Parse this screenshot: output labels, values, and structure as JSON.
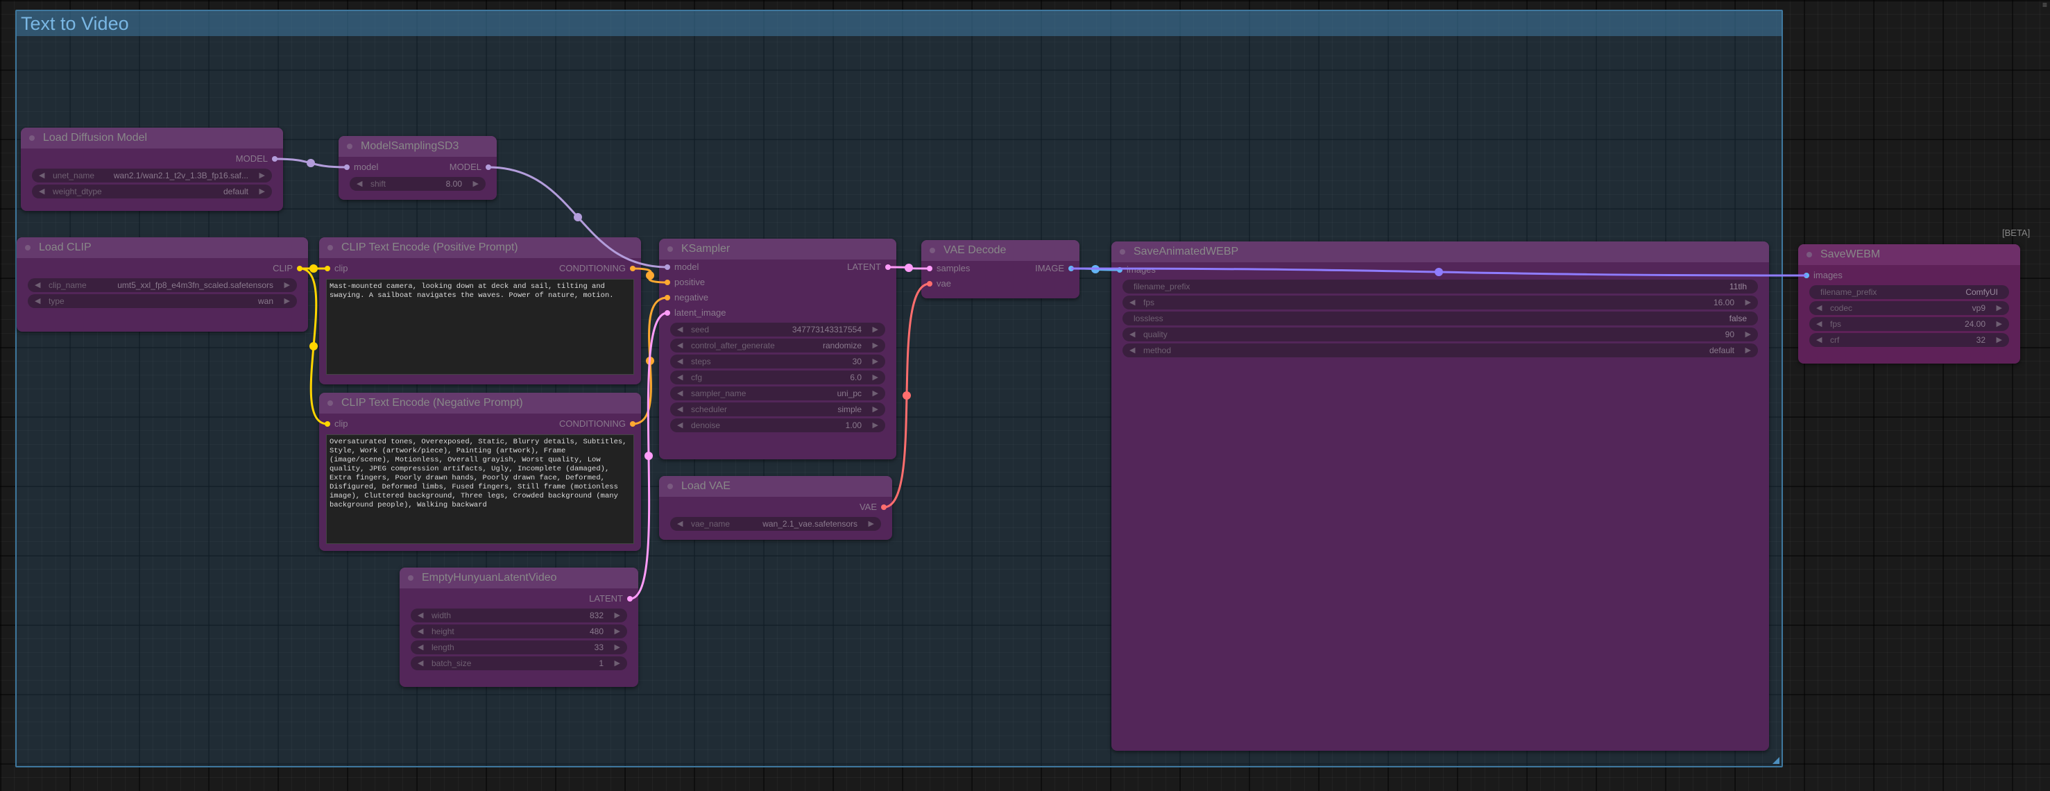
{
  "group": {
    "title": "Text to Video"
  },
  "beta_badge": "[BETA]",
  "nodes": {
    "load_diffusion_model": {
      "title": "Load Diffusion Model",
      "output": "MODEL",
      "widgets": [
        {
          "name": "unet_name",
          "value": "wan2.1/wan2.1_t2v_1.3B_fp16.saf..."
        },
        {
          "name": "weight_dtype",
          "value": "default"
        }
      ]
    },
    "model_sampling": {
      "title": "ModelSamplingSD3",
      "input": "model",
      "output": "MODEL",
      "widgets": [
        {
          "name": "shift",
          "value": "8.00"
        }
      ]
    },
    "load_clip": {
      "title": "Load CLIP",
      "output": "CLIP",
      "widgets": [
        {
          "name": "clip_name",
          "value": "umt5_xxl_fp8_e4m3fn_scaled.safetensors"
        },
        {
          "name": "type",
          "value": "wan"
        }
      ]
    },
    "clip_positive": {
      "title": "CLIP Text Encode (Positive Prompt)",
      "input": "clip",
      "output": "CONDITIONING",
      "text": "Mast-mounted camera, looking down at deck and sail, tilting and swaying. A sailboat navigates the waves. Power of nature, motion."
    },
    "clip_negative": {
      "title": "CLIP Text Encode (Negative Prompt)",
      "input": "clip",
      "output": "CONDITIONING",
      "text": "Oversaturated tones, Overexposed, Static, Blurry details, Subtitles, Style, Work (artwork/piece), Painting (artwork), Frame (image/scene), Motionless, Overall grayish, Worst quality, Low quality, JPEG compression artifacts, Ugly, Incomplete (damaged), Extra fingers, Poorly drawn hands, Poorly drawn face, Deformed, Disfigured, Deformed limbs, Fused fingers, Still frame (motionless image), Cluttered background, Three legs, Crowded background (many background people), Walking backward"
    },
    "empty_latent": {
      "title": "EmptyHunyuanLatentVideo",
      "output": "LATENT",
      "widgets": [
        {
          "name": "width",
          "value": "832"
        },
        {
          "name": "height",
          "value": "480"
        },
        {
          "name": "length",
          "value": "33"
        },
        {
          "name": "batch_size",
          "value": "1"
        }
      ]
    },
    "ksampler": {
      "title": "KSampler",
      "inputs": [
        "model",
        "positive",
        "negative",
        "latent_image"
      ],
      "output": "LATENT",
      "widgets": [
        {
          "name": "seed",
          "value": "347773143317554"
        },
        {
          "name": "control_after_generate",
          "value": "randomize"
        },
        {
          "name": "steps",
          "value": "30"
        },
        {
          "name": "cfg",
          "value": "6.0"
        },
        {
          "name": "sampler_name",
          "value": "uni_pc"
        },
        {
          "name": "scheduler",
          "value": "simple"
        },
        {
          "name": "denoise",
          "value": "1.00"
        }
      ]
    },
    "load_vae": {
      "title": "Load VAE",
      "output": "VAE",
      "widgets": [
        {
          "name": "vae_name",
          "value": "wan_2.1_vae.safetensors"
        }
      ]
    },
    "vae_decode": {
      "title": "VAE Decode",
      "inputs": [
        "samples",
        "vae"
      ],
      "output": "IMAGE"
    },
    "save_webp": {
      "title": "SaveAnimatedWEBP",
      "input": "images",
      "widgets": [
        {
          "name": "filename_prefix",
          "value": "11tlh"
        },
        {
          "name": "fps",
          "value": "16.00"
        },
        {
          "name": "lossless",
          "value": "false"
        },
        {
          "name": "quality",
          "value": "90"
        },
        {
          "name": "method",
          "value": "default"
        }
      ]
    },
    "save_webm": {
      "title": "SaveWEBM",
      "input": "images",
      "widgets": [
        {
          "name": "filename_prefix",
          "value": "ComfyUI"
        },
        {
          "name": "codec",
          "value": "vp9"
        },
        {
          "name": "fps",
          "value": "24.00"
        },
        {
          "name": "crf",
          "value": "32"
        }
      ]
    }
  },
  "colors": {
    "model": "#b39ddb",
    "clip": "#ffd500",
    "conditioning": "#ffa931",
    "latent": "#ff9cf9",
    "vae": "#ff6e6e",
    "image": "#64b5f6"
  }
}
